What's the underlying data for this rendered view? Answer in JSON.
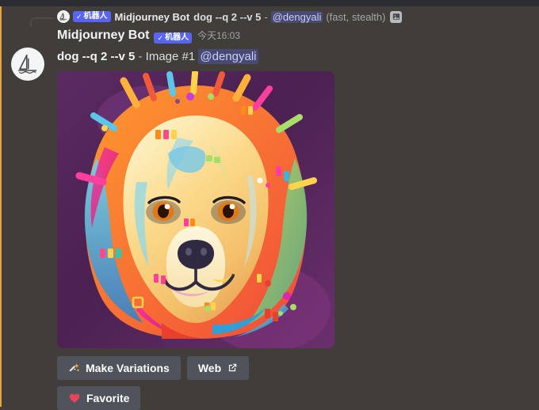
{
  "theme": {
    "background": "#413e39",
    "top_bar": "#2b2d31",
    "mention_bar": "#e8a33d",
    "bot_tag_bg": "#5865f2",
    "button_bg": "#4f545c",
    "mention_pill_bg": "#4a4d7a",
    "mention_text": "#c9cdfb"
  },
  "reply_preview": {
    "avatar_icon": "midjourney-sailboat-icon",
    "bot_tag": {
      "check": "✓",
      "label": "机器人"
    },
    "author": "Midjourney Bot",
    "prompt": "dog --q 2 --v 5",
    "separator": "-",
    "mention": "@dengyali",
    "meta": "(fast, stealth)",
    "attachment_icon": "image-attachment-icon"
  },
  "message": {
    "avatar_icon": "midjourney-sailboat-icon",
    "author": "Midjourney Bot",
    "bot_tag": {
      "check": "✓",
      "label": "机器人"
    },
    "timestamp_day": "今天",
    "timestamp_time": "16:03",
    "content": {
      "prompt": "dog --q 2 --v 5",
      "separator": "-",
      "image_label": "Image #1",
      "mention": "@dengyali"
    },
    "attachment": {
      "name": "generated-image",
      "alt": "Colorful pop-art painted portrait of a dog on purple background",
      "width": "350",
      "height": "350"
    },
    "buttons": [
      {
        "label": "Make Variations",
        "icon": "magic-wand-icon",
        "name": "make-variations-button"
      },
      {
        "label": "Web",
        "icon": "external-link-icon",
        "name": "web-button"
      },
      {
        "label": "Favorite",
        "icon": "heart-icon",
        "name": "favorite-button"
      }
    ]
  }
}
